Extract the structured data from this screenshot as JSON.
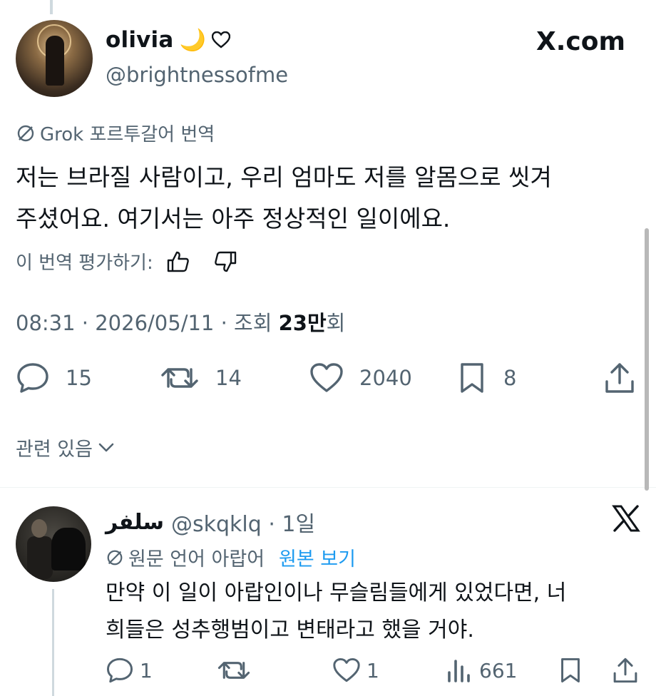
{
  "tweet": {
    "display_name": "olivia",
    "name_emoji": "🌙",
    "handle": "@brightnessofme",
    "brand": "X.com",
    "translation_tag": "Grok 포르투갈어 번역",
    "text_line1": "저는 브라질 사람이고, 우리 엄마도 저를 알몸으로 씻겨",
    "text_line2": "주셨어요. 여기서는 아주 정상적인 일이에요.",
    "rate_label": "이 번역 평가하기:",
    "meta_prefix": "08:31 · 2026/05/11 · 조회 ",
    "meta_views": "23만",
    "meta_suffix": "회",
    "stats": {
      "replies": "15",
      "reposts": "14",
      "likes": "2040",
      "bookmarks": "8"
    },
    "related_label": "관련 있음"
  },
  "reply": {
    "display_name": "سلفر",
    "handle_time": "@skqklq · 1일",
    "source_tag": "원문 언어 아랍어",
    "view_original": "원본 보기",
    "text_line1": "만약 이 일이 아랍인이나 무슬림들에게 있었다면, 너",
    "text_line2": "희들은 성추행범이고 변태라고 했을 거야.",
    "stats": {
      "replies": "1",
      "likes": "1",
      "views": "661"
    }
  },
  "colors": {
    "text": "#0f1419",
    "secondary": "#536471",
    "link": "#1d9bf0",
    "divider": "#eff3f4"
  }
}
